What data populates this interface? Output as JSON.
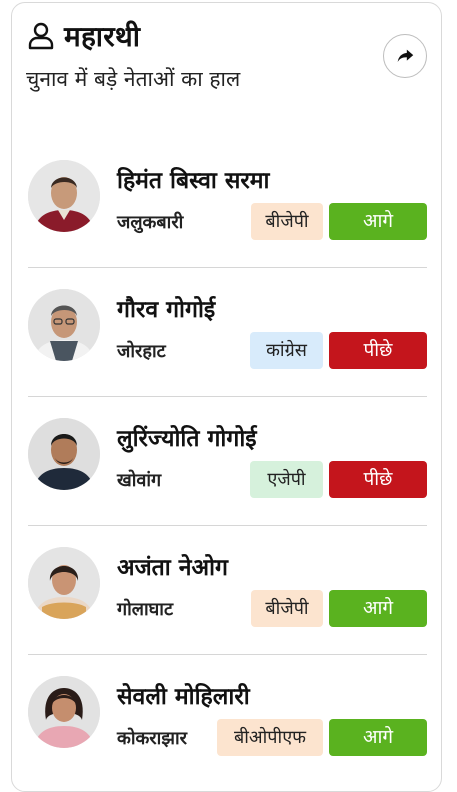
{
  "header": {
    "title": "महारथी",
    "subtitle": "चुनाव में बड़े नेताओं का हाल",
    "icons": {
      "title": "person-icon",
      "share": "share-arrow-icon"
    }
  },
  "colors": {
    "lead": "#5ab21f",
    "trail": "#c4151c",
    "party_bjp": "#fce4cf",
    "party_congress": "#d8ebfb",
    "party_agp": "#d6f1dc"
  },
  "candidates": [
    {
      "name": "हिमंत बिस्वा सरमा",
      "constituency": "जलुकबारी",
      "party": "बीजेपी",
      "status": "आगे"
    },
    {
      "name": "गौरव गोगोई",
      "constituency": "जोरहाट",
      "party": "कांग्रेस",
      "status": "पीछे"
    },
    {
      "name": "लुरिंज्योति गोगोई",
      "constituency": "खोवांग",
      "party": "एजेपी",
      "status": "पीछे"
    },
    {
      "name": "अजंता नेओग",
      "constituency": "गोलाघाट",
      "party": "बीजेपी",
      "status": "आगे"
    },
    {
      "name": "सेवली मोहिलारी",
      "constituency": "कोकराझार",
      "party": "बीओपीएफ",
      "status": "आगे"
    }
  ]
}
